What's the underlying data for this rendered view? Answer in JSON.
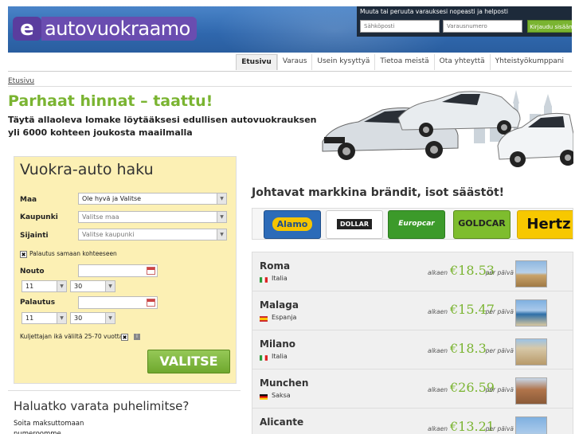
{
  "header": {
    "logo_e": "e",
    "logo_text": "autovuokraamo",
    "login": {
      "title": "Muuta tai peruuta varauksesi nopeasti ja helposti",
      "email_placeholder": "Sähköposti",
      "reservation_placeholder": "Varausnumero",
      "submit_label": "Kirjaudu sisään"
    }
  },
  "nav": {
    "items": [
      {
        "label": "Etusivu",
        "active": true
      },
      {
        "label": "Varaus"
      },
      {
        "label": "Usein kysyttyä"
      },
      {
        "label": "Tietoa meistä"
      },
      {
        "label": "Ota yhteyttä"
      },
      {
        "label": "Yhteistyökumppani"
      }
    ]
  },
  "breadcrumb": "Etusivu",
  "hero": {
    "title": "Parhaat hinnat – taattu!",
    "subtitle": "Täytä allaoleva lomake löytääksesi edullisen autovuokrauksen yli 6000 kohteen joukosta maailmalla"
  },
  "search": {
    "title": "Vuokra-auto haku",
    "country_label": "Maa",
    "country_value": "Ole hyvä ja Valitse",
    "city_label": "Kaupunki",
    "city_value": "Valitse maa",
    "location_label": "Sijainti",
    "location_value": "Valitse kaupunki",
    "same_return_label": "Palautus samaan kohteeseen",
    "pickup_label": "Nouto",
    "pickup_hour": "11",
    "pickup_min": "30",
    "return_label": "Palautus",
    "return_hour": "11",
    "return_min": "30",
    "driver_age_label": "Kuljettajan ikä väliltä 25-70 vuotta?",
    "submit_label": "VALITSE"
  },
  "phone": {
    "title": "Haluatko varata puhelimitse?",
    "text": "Soita maksuttomaan numeroomme"
  },
  "brands": {
    "title": "Johtavat markkina brändit, isot säästöt!",
    "items": [
      "Alamo",
      "DOLLAR",
      "Europcar",
      "GOLDCAR",
      "Hertz"
    ]
  },
  "destinations": {
    "from_label": "alkaen",
    "per_day_label": "per päivä",
    "items": [
      {
        "city": "Roma",
        "country": "Italia",
        "price": "€18.53"
      },
      {
        "city": "Malaga",
        "country": "Espanja",
        "price": "€15.47"
      },
      {
        "city": "Milano",
        "country": "Italia",
        "price": "€18.3"
      },
      {
        "city": "Munchen",
        "country": "Saksa",
        "price": "€26.59"
      },
      {
        "city": "Alicante",
        "country": "",
        "price": "€13.21"
      }
    ]
  },
  "colors": {
    "accent_green": "#7ab431",
    "header_blue": "#2f67ad",
    "search_bg": "#fcf0b4"
  }
}
